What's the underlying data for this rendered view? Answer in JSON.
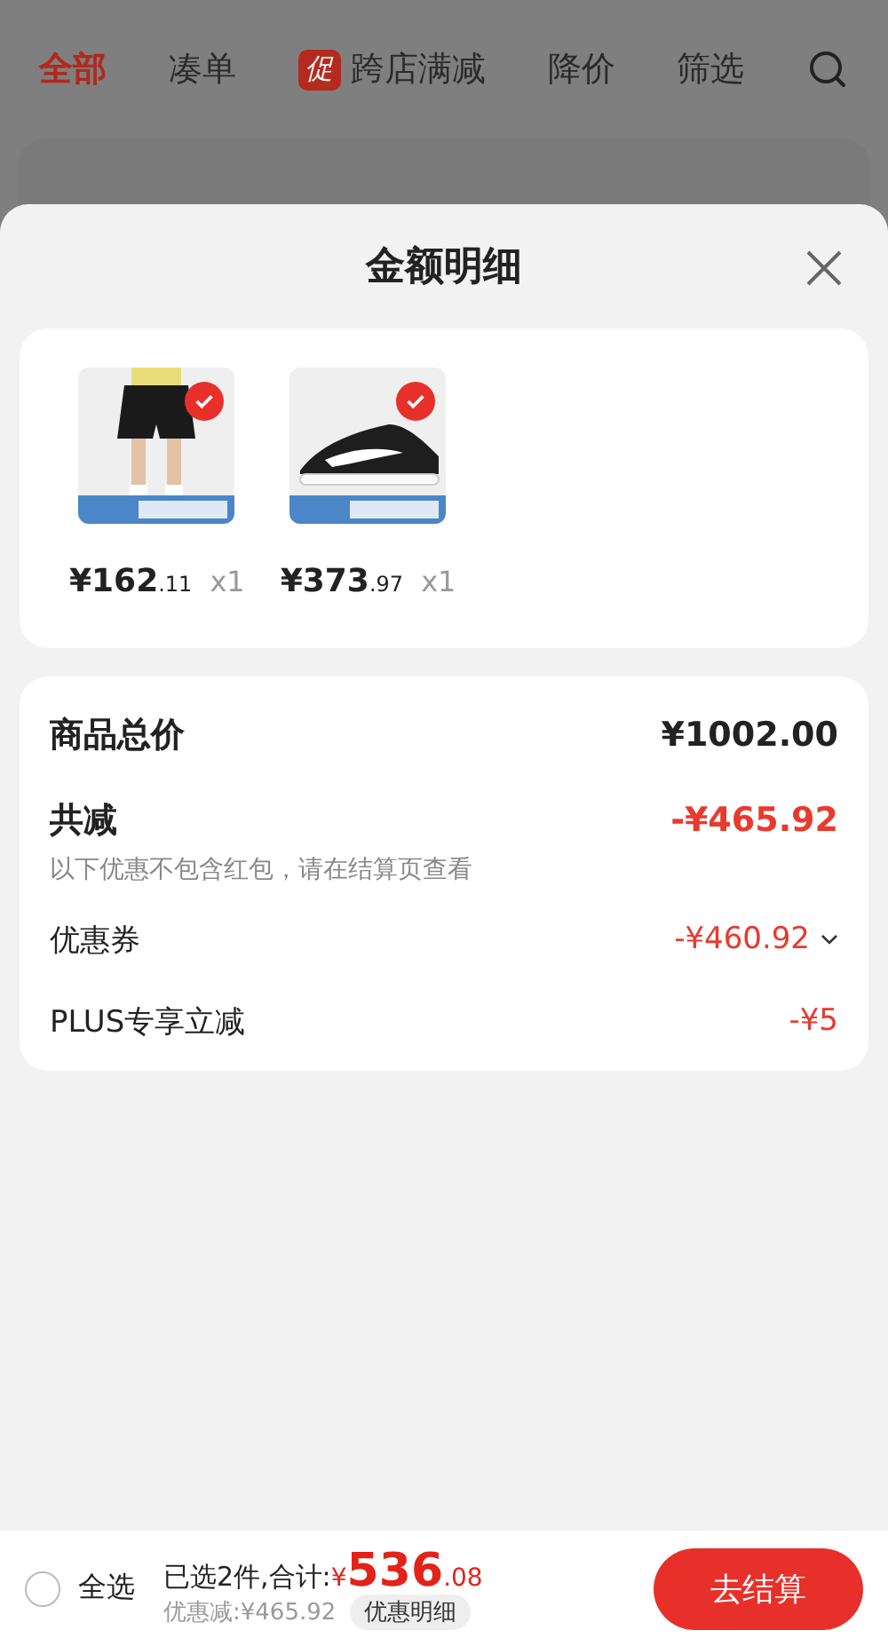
{
  "tabs": [
    {
      "label": "全部",
      "selected": true
    },
    {
      "label": "凑单",
      "selected": false
    },
    {
      "label": "跨店满减",
      "selected": false,
      "badge": "促"
    },
    {
      "label": "降价",
      "selected": false
    },
    {
      "label": "筛选",
      "selected": false
    }
  ],
  "sheet": {
    "title": "金额明细",
    "products": [
      {
        "kind": "picture",
        "selected": true,
        "price_int": "¥162",
        "price_dec": ".11",
        "qty": "x1"
      },
      {
        "kind": "picture",
        "selected": true,
        "price_int": "¥373",
        "price_dec": ".97",
        "qty": "x1"
      }
    ],
    "total": {
      "label": "商品总价",
      "value": "¥1002.00"
    },
    "discount": {
      "label": "共减",
      "value": "-¥465.92",
      "note": "以下优惠不包含红包，请在结算页查看"
    },
    "items": [
      {
        "label": "优惠券",
        "value": "-¥460.92",
        "expandable": true
      },
      {
        "label": "PLUS专享立减",
        "value": "-¥5",
        "expandable": false
      }
    ]
  },
  "bottom_bar": {
    "select_all": {
      "label": "全选",
      "checked": false
    },
    "summary": "已选2件,合计:",
    "currency": "¥",
    "amount_int": "536",
    "amount_dec": ".08",
    "saved": "优惠减:¥465.92",
    "detail_button": "优惠明细",
    "checkout": "去结算"
  }
}
